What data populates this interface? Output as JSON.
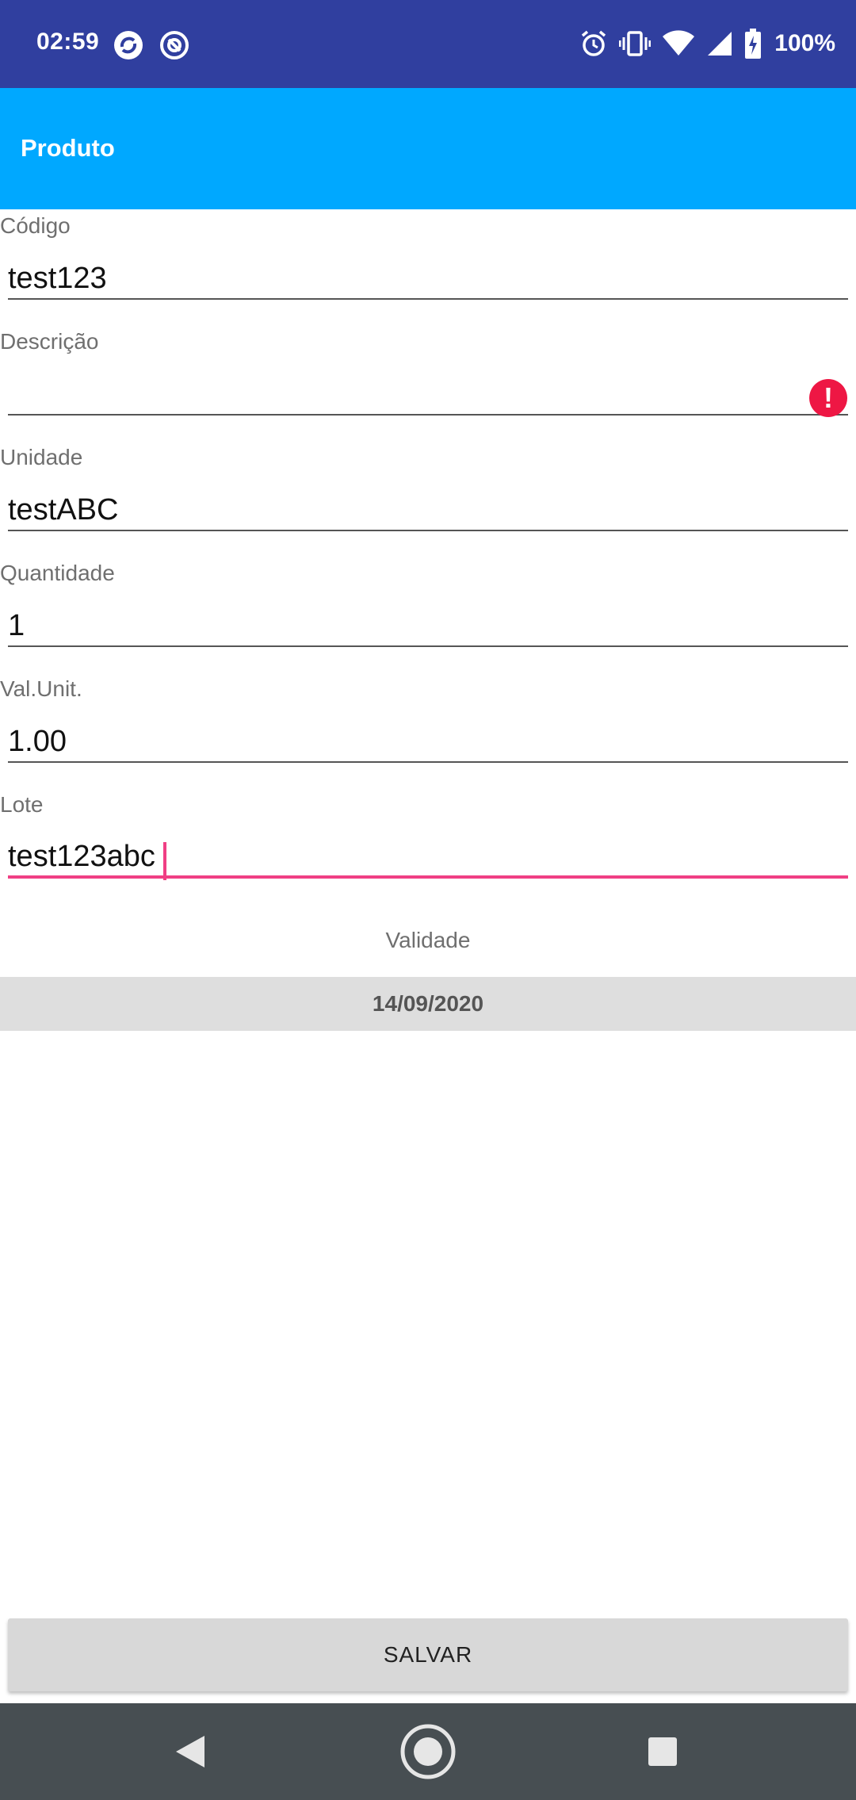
{
  "status_bar": {
    "time": "02:59",
    "battery": "100%",
    "left_icons": [
      "sync-app-icon",
      "app-badge-icon"
    ],
    "right_icons": [
      "alarm-icon",
      "vibrate-icon",
      "wifi-icon",
      "signal-icon",
      "battery-charging-icon"
    ]
  },
  "app_bar": {
    "title": "Produto"
  },
  "form": {
    "codigo": {
      "label": "Código",
      "value": "test123"
    },
    "descricao": {
      "label": "Descrição",
      "value": ""
    },
    "unidade": {
      "label": "Unidade",
      "value": "testABC"
    },
    "quantidade": {
      "label": "Quantidade",
      "value": "1"
    },
    "valor_unit": {
      "label": "Val.Unit.",
      "value": "1.00"
    },
    "lote": {
      "label": "Lote",
      "value": "test123abc"
    },
    "validade": {
      "label": "Validade",
      "value": "14/09/2020"
    }
  },
  "actions": {
    "save_label": "SALVAR"
  },
  "colors": {
    "status_bar": "#303f9f",
    "app_bar": "#00a8ff",
    "accent": "#f03f84",
    "error": "#ee1744",
    "nav_bar": "#474e52"
  }
}
